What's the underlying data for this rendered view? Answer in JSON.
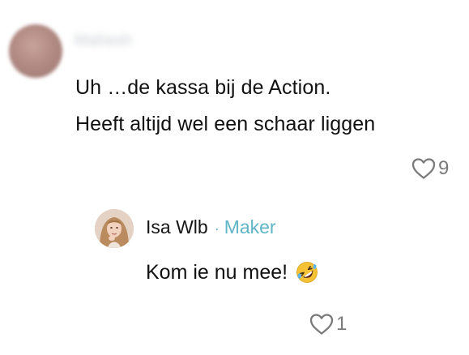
{
  "comment": {
    "username": "Mahesh",
    "lines": [
      "Uh …de kassa bij de Action.",
      "Heeft altijd wel een schaar liggen"
    ],
    "likes": "9"
  },
  "reply": {
    "author": "Isa Wlb",
    "separator": "·",
    "role": "Maker",
    "text": "Kom ie nu mee!",
    "emoji_icon": "rolling-on-floor-laughing-emoji",
    "likes": "1"
  },
  "colors": {
    "maker_accent": "#5fb5c7",
    "muted": "#7a7a7a"
  }
}
